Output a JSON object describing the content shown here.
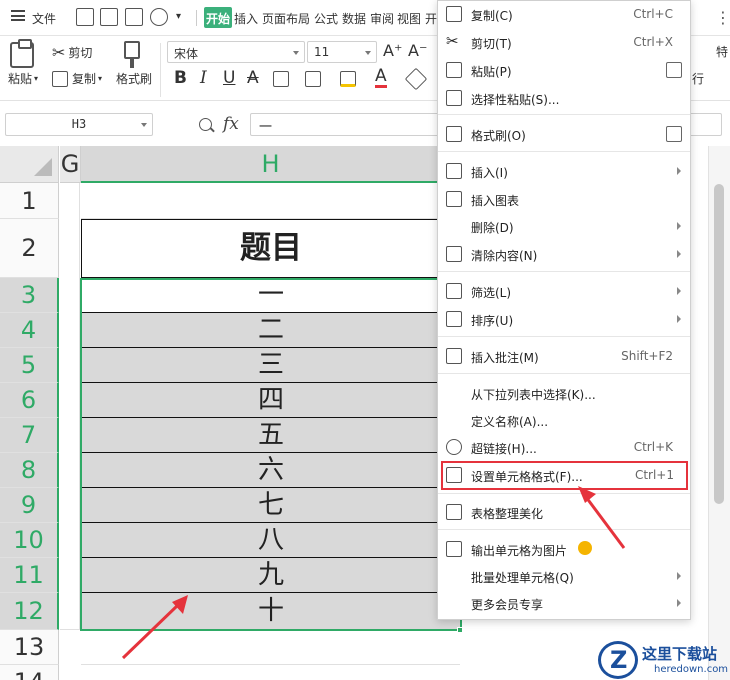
{
  "menubar": {
    "file": "文件",
    "tabs": [
      "开始",
      "插入",
      "页面布局",
      "公式",
      "数据",
      "审阅",
      "视图",
      "开"
    ],
    "active_tab": "开始"
  },
  "ribbon": {
    "paste": "粘贴",
    "cut": "剪切",
    "copy": "复制",
    "format_painter": "格式刷",
    "font_name": "宋体",
    "font_size": "11",
    "bold": "B",
    "italic": "I",
    "underline": "U",
    "font_color_letter": "A",
    "right_clip": "行",
    "right_clip2": "特"
  },
  "formula_bar": {
    "name_box": "H3",
    "fx": "fx",
    "value": "一"
  },
  "sheet": {
    "columns": [
      "G",
      "H"
    ],
    "selected_column": "H",
    "rows": [
      {
        "num": "1",
        "value": ""
      },
      {
        "num": "2",
        "value": "题目"
      },
      {
        "num": "3",
        "value": "一"
      },
      {
        "num": "4",
        "value": "二"
      },
      {
        "num": "5",
        "value": "三"
      },
      {
        "num": "6",
        "value": "四"
      },
      {
        "num": "7",
        "value": "五"
      },
      {
        "num": "8",
        "value": "六"
      },
      {
        "num": "9",
        "value": "七"
      },
      {
        "num": "10",
        "value": "八"
      },
      {
        "num": "11",
        "value": "九"
      },
      {
        "num": "12",
        "value": "十"
      },
      {
        "num": "13",
        "value": ""
      },
      {
        "num": "14",
        "value": ""
      }
    ],
    "selection_color": "#2faa66"
  },
  "context_menu": {
    "items": [
      {
        "label": "复制(C)",
        "shortcut": "Ctrl+C",
        "icon": "copy-icon"
      },
      {
        "label": "剪切(T)",
        "shortcut": "Ctrl+X",
        "icon": "scissors-icon"
      },
      {
        "label": "粘贴(P)",
        "shortcut": "",
        "icon": "paste-icon"
      },
      {
        "label": "选择性粘贴(S)...",
        "shortcut": "",
        "icon": "paste-special-icon"
      },
      {
        "label": "格式刷(O)",
        "shortcut": "",
        "icon": "format-brush-icon"
      },
      {
        "label": "插入(I)",
        "shortcut": "",
        "icon": "insert-icon"
      },
      {
        "label": "插入图表",
        "shortcut": "",
        "icon": "chart-icon"
      },
      {
        "label": "删除(D)",
        "shortcut": "",
        "icon": ""
      },
      {
        "label": "清除内容(N)",
        "shortcut": "",
        "icon": "eraser-icon"
      },
      {
        "label": "筛选(L)",
        "shortcut": "",
        "icon": "filter-icon"
      },
      {
        "label": "排序(U)",
        "shortcut": "",
        "icon": "sort-icon"
      },
      {
        "label": "插入批注(M)",
        "shortcut": "Shift+F2",
        "icon": "comment-icon"
      },
      {
        "label": "从下拉列表中选择(K)...",
        "shortcut": "",
        "icon": ""
      },
      {
        "label": "定义名称(A)...",
        "shortcut": "",
        "icon": ""
      },
      {
        "label": "超链接(H)...",
        "shortcut": "Ctrl+K",
        "icon": "link-icon"
      },
      {
        "label": "设置单元格格式(F)...",
        "shortcut": "Ctrl+1",
        "icon": "format-cells-icon"
      },
      {
        "label": "表格整理美化",
        "shortcut": "",
        "icon": "beautify-icon"
      },
      {
        "label": "输出单元格为图片",
        "shortcut": "",
        "icon": "image-export-icon"
      },
      {
        "label": "批量处理单元格(Q)",
        "shortcut": "",
        "icon": ""
      },
      {
        "label": "更多会员专享",
        "shortcut": "",
        "icon": ""
      }
    ],
    "highlight_color": "#e5333c"
  },
  "watermark": {
    "title": "这里下载站",
    "domain": "heredown.com"
  }
}
